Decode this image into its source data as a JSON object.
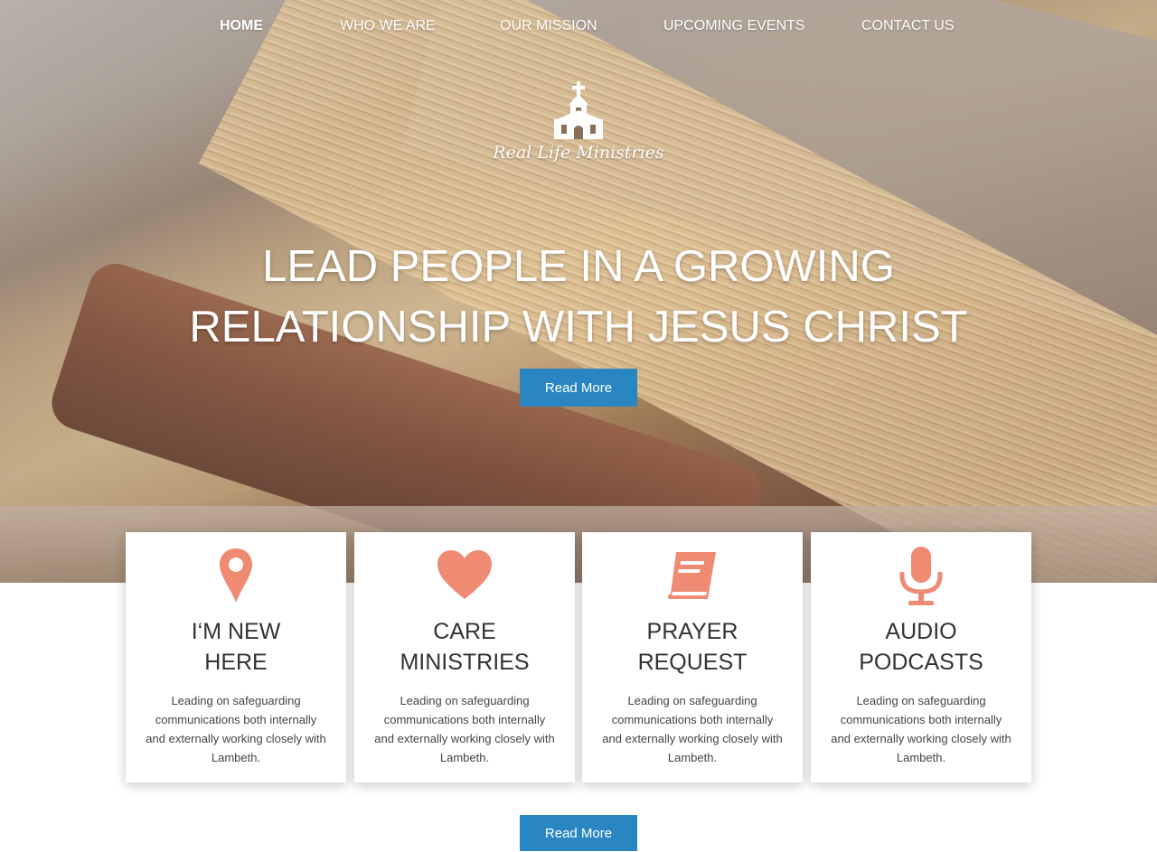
{
  "nav": {
    "items": [
      {
        "label": "HOME",
        "active": true
      },
      {
        "label": "WHO WE ARE",
        "active": false
      },
      {
        "label": "OUR MISSION",
        "active": false
      },
      {
        "label": "UPCOMING EVENTS",
        "active": false
      },
      {
        "label": "CONTACT US",
        "active": false
      }
    ]
  },
  "logo": {
    "icon": "church-icon",
    "text": "Real Life Ministries"
  },
  "hero": {
    "headline_line1": "LEAD PEOPLE IN A GROWING",
    "headline_line2": "RELATIONSHIP WITH JESUS CHRIST",
    "button_label": "Read More"
  },
  "features": [
    {
      "icon": "map-pin-icon",
      "title_line1": "I‘M NEW",
      "title_line2": "HERE",
      "text": "Leading on safeguarding communications both internally and externally working closely with Lambeth."
    },
    {
      "icon": "heart-icon",
      "title_line1": "CARE",
      "title_line2": "MINISTRIES",
      "text": "Leading on safeguarding communications both internally and externally working closely with Lambeth."
    },
    {
      "icon": "book-icon",
      "title_line1": "PRAYER",
      "title_line2": "REQUEST",
      "text": "Leading on safeguarding communications both internally and externally working closely with Lambeth."
    },
    {
      "icon": "microphone-icon",
      "title_line1": "AUDIO",
      "title_line2": "PODCASTS",
      "text": "Leading on safeguarding communications both internally and externally working closely with Lambeth."
    }
  ],
  "bottom_button_label": "Read More",
  "colors": {
    "accent_icon": "#ef8a73",
    "button": "#2a86c2"
  }
}
